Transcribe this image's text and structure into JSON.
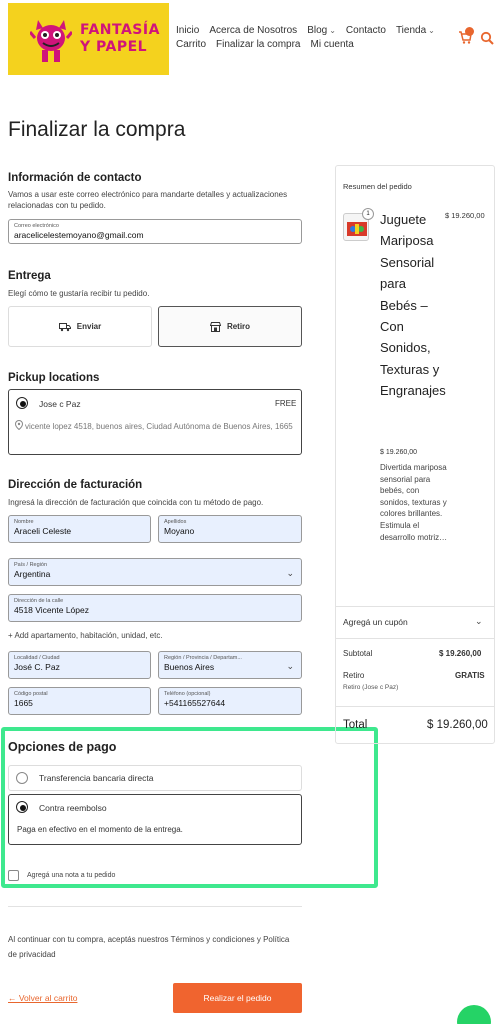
{
  "header": {
    "logo_text_line1": "FANTASÍA",
    "logo_text_line2": "Y PAPEL",
    "nav": [
      "Inicio",
      "Acerca de Nosotros",
      "Blog",
      "Contacto",
      "Tienda",
      "Carrito",
      "Finalizar la compra",
      "Mi cuenta"
    ],
    "cart_icon": "cart-icon",
    "search_icon": "search-icon"
  },
  "page_title": "Finalizar la compra",
  "contact": {
    "title": "Información de contacto",
    "desc": "Vamos a usar este correo electrónico para mandarte detalles y actualizaciones relacionadas con tu pedido.",
    "email_label": "Correo electrónico",
    "email_value": "aracelicelestemoyano@gmail.com"
  },
  "delivery": {
    "title": "Entrega",
    "desc": "Elegí cómo te gustaría recibir tu pedido.",
    "ship_label": "Enviar",
    "pickup_label": "Retiro"
  },
  "pickup": {
    "title": "Pickup locations",
    "location_name": "Jose c Paz",
    "price": "FREE",
    "address": "vicente lopez 4518, buenos aires, Ciudad Autónoma de Buenos Aires, 1665"
  },
  "billing": {
    "title": "Dirección de facturación",
    "desc": "Ingresá la dirección de facturación que coincida con tu método de pago.",
    "nombre_label": "Nombre",
    "nombre_value": "Araceli Celeste",
    "apellidos_label": "Apellidos",
    "apellidos_value": "Moyano",
    "pais_label": "País / Región",
    "pais_value": "Argentina",
    "calle_label": "Dirección de la calle",
    "calle_value": "4518 Vicente López",
    "add_apartment": "+ Add apartamento, habitación, unidad, etc.",
    "localidad_label": "Localidad / Ciudad",
    "localidad_value": "José C. Paz",
    "region_label": "Región / Provincia / Departam...",
    "region_value": "Buenos Aires",
    "cp_label": "Código postal",
    "cp_value": "1665",
    "tel_label": "Teléfono (opcional)",
    "tel_value": "+541165527644"
  },
  "payment": {
    "title": "Opciones de pago",
    "option1": "Transferencia bancaria directa",
    "option2": "Contra reembolso",
    "option2_desc": "Paga en efectivo en el momento de la entrega.",
    "note_label": "Agregá una nota a tu pedido"
  },
  "terms": "Al continuar con tu compra, aceptás nuestros Términos y condiciones y Política de privacidad",
  "back_link": "←  Volver al carrito",
  "place_order": "Realizar el pedido",
  "summary": {
    "title": "Resumen del pedido",
    "qty": "1",
    "product_name": "Juguete Mariposa Sensorial para Bebés – Con Sonidos, Texturas y Engranajes",
    "product_price": "$ 19.260,00",
    "product_desc": "Divertida mariposa sensorial para bebés, con sonidos, texturas y colores brillantes. Estimula el desarrollo motriz…",
    "coupon": "Agregá un cupón",
    "subtotal_label": "Subtotal",
    "subtotal_value": "$ 19.260,00",
    "retiro_label": "Retiro",
    "retiro_value": "GRATIS",
    "retiro_sub": "Retiro (Jose c Paz)",
    "total_label": "Total",
    "total_value": "$ 19.260,00"
  },
  "colors": {
    "accent": "#f0642f",
    "highlight": "#3ee88e",
    "logo_bg": "#f4d21e",
    "logo_text": "#d0147a"
  }
}
